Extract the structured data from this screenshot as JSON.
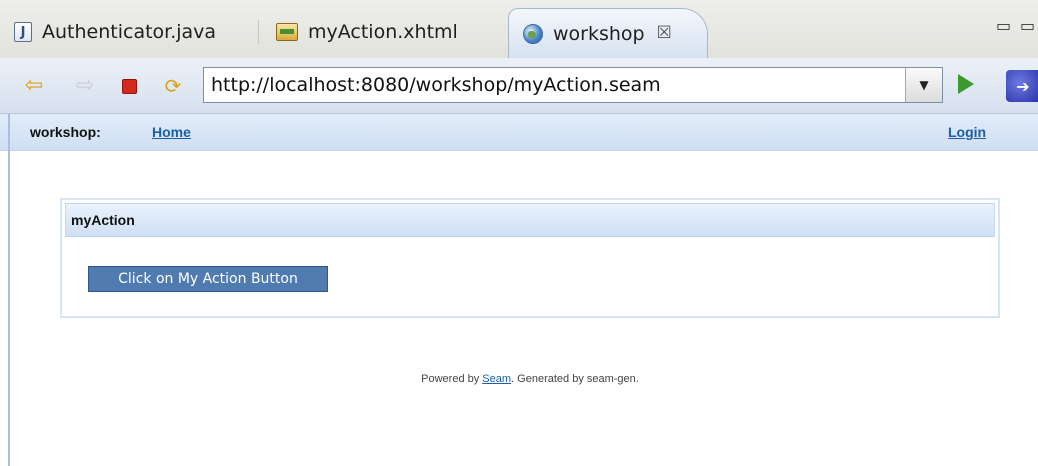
{
  "editor_tabs": [
    {
      "label": "Authenticator.java",
      "icon": "java-file-icon"
    },
    {
      "label": "myAction.xhtml",
      "icon": "xhtml-file-icon"
    },
    {
      "label": "workshop",
      "icon": "globe-icon",
      "close": "☒",
      "active": true
    }
  ],
  "window_controls": {
    "minimize": "▭",
    "maximize": "▭"
  },
  "browser_toolbar": {
    "back_icon": "⇦",
    "forward_icon": "⇨",
    "refresh_icon": "⟳",
    "url": "http://localhost:8080/workshop/myAction.seam",
    "dropdown_icon": "▼"
  },
  "seam_menu": {
    "title": "workshop:",
    "home_link": "Home",
    "login_link": "Login"
  },
  "panel": {
    "header": "myAction",
    "button_label": "Click on My Action Button"
  },
  "footer": {
    "prefix": "Powered by ",
    "link": "Seam",
    "suffix": ". Generated by seam-gen."
  },
  "colors": {
    "menu_link": "#1d5fa6",
    "button_bg": "#4f7bb0",
    "header_gradient_top": "#eaf2fc",
    "header_gradient_bottom": "#cfe0f5"
  }
}
